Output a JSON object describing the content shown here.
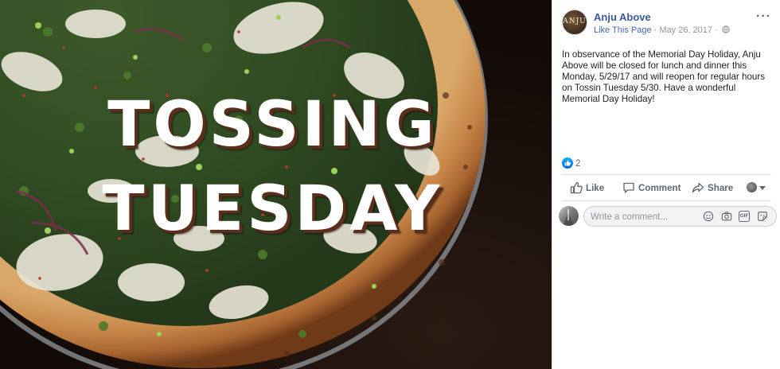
{
  "photo": {
    "overlay_line_1": "TOSSING",
    "overlay_line_2": "TUESDAY"
  },
  "post": {
    "page_name": "Anju Above",
    "avatar_text": "ANJU",
    "like_page_label": "Like This Page",
    "separator": " · ",
    "date": "May 26, 2017",
    "separator2": " · ",
    "audience_icon": "globe-icon",
    "more_label": "···",
    "text": "In observance of the Memorial Day Holiday, Anju Above will be closed for lunch and dinner this Monday, 5/29/17 and will reopen for regular hours on Tossin Tuesday 5/30. Have a wonderful Memorial Day Holiday!",
    "reaction_count": "2"
  },
  "actions": {
    "like_label": "Like",
    "comment_label": "Comment",
    "share_label": "Share"
  },
  "comment": {
    "placeholder": "Write a comment..."
  },
  "colors": {
    "link": "#385898",
    "like_link": "#4267b2",
    "muted": "#90949c",
    "text": "#1c1e21",
    "action_text": "#606770",
    "divider": "#dadde1",
    "reaction_blue": "#1877f2"
  }
}
